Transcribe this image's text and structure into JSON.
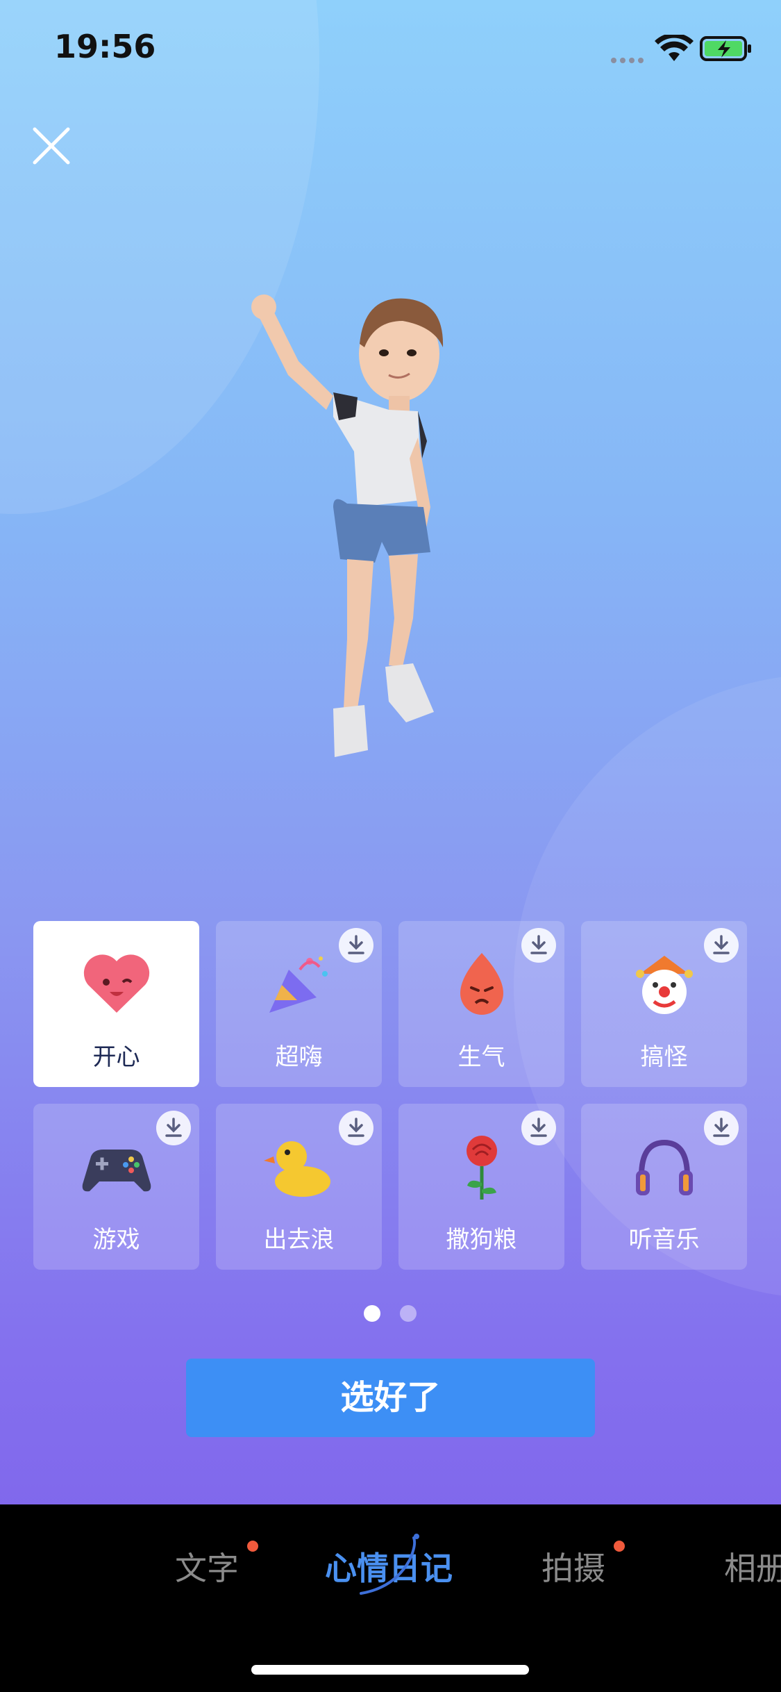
{
  "status_bar": {
    "time": "19:56"
  },
  "moods": [
    {
      "label": "开心",
      "icon": "smiling-heart-icon",
      "selected": true,
      "downloadable": false
    },
    {
      "label": "超嗨",
      "icon": "party-popper-icon",
      "selected": false,
      "downloadable": true
    },
    {
      "label": "生气",
      "icon": "angry-flame-icon",
      "selected": false,
      "downloadable": true
    },
    {
      "label": "搞怪",
      "icon": "clown-face-icon",
      "selected": false,
      "downloadable": true
    },
    {
      "label": "游戏",
      "icon": "game-controller-icon",
      "selected": false,
      "downloadable": true
    },
    {
      "label": "出去浪",
      "icon": "rubber-duck-icon",
      "selected": false,
      "downloadable": true
    },
    {
      "label": "撒狗粮",
      "icon": "rose-icon",
      "selected": false,
      "downloadable": true
    },
    {
      "label": "听音乐",
      "icon": "headphones-icon",
      "selected": false,
      "downloadable": true
    }
  ],
  "pager": {
    "pages": 2,
    "current": 1
  },
  "confirm_button": {
    "label": "选好了"
  },
  "tabs": [
    {
      "label": "文字",
      "active": false,
      "has_dot": true
    },
    {
      "label": "心情日记",
      "active": true,
      "has_dot": false
    },
    {
      "label": "拍摄",
      "active": false,
      "has_dot": true
    },
    {
      "label": "相册",
      "active": false,
      "has_dot": false
    }
  ],
  "colors": {
    "accent": "#3d8ff5",
    "active_tab": "#4a90f0",
    "notification_dot": "#f05a3c",
    "selected_cell": "#ffffff"
  }
}
